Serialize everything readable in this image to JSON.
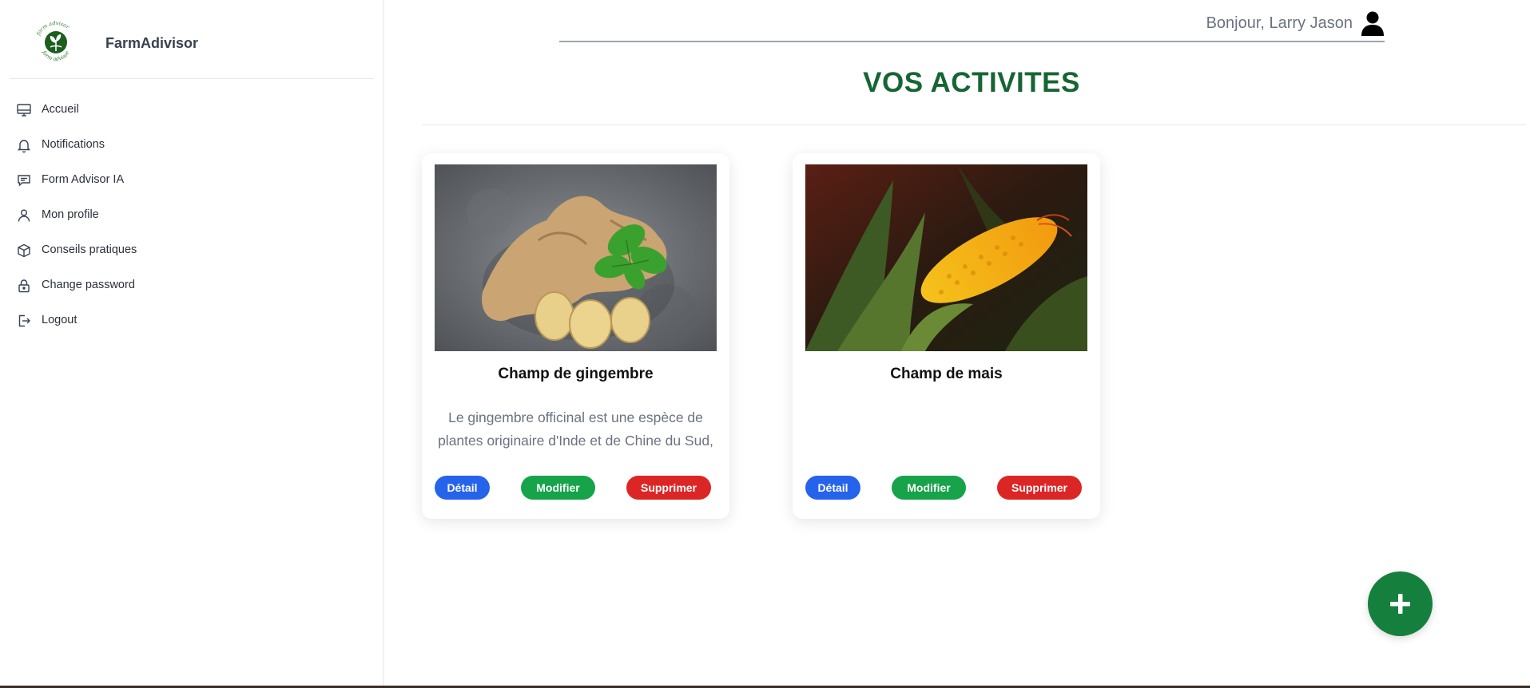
{
  "sidebar": {
    "brand": {
      "name": "FarmAdivisor",
      "logo_text_top": "form advisor",
      "logo_text_bottom": "form advisor"
    },
    "items": [
      {
        "label": "Accueil",
        "icon": "monitor-icon"
      },
      {
        "label": "Notifications",
        "icon": "bell-icon"
      },
      {
        "label": "Form Advisor IA",
        "icon": "chat-icon"
      },
      {
        "label": "Mon profile",
        "icon": "user-icon"
      },
      {
        "label": "Conseils pratiques",
        "icon": "cube-icon"
      },
      {
        "label": "Change password",
        "icon": "lock-icon"
      },
      {
        "label": "Logout",
        "icon": "logout-icon"
      }
    ]
  },
  "header": {
    "greeting": "Bonjour, Larry Jason",
    "user_icon": "user-solid-icon"
  },
  "main": {
    "title": "VOS ACTIVITES",
    "cards": [
      {
        "title": "Champ de gingembre",
        "description": "Le gingembre officinal est une espèce de plantes originaire d'Inde et de Chine du Sud, ... Elle appartient à la famille des ...",
        "image": "ginger-photo",
        "buttons": {
          "detail": "Détail",
          "modify": "Modifier",
          "delete": "Supprimer"
        }
      },
      {
        "title": "Champ de mais",
        "description": "",
        "image": "corn-photo",
        "buttons": {
          "detail": "Détail",
          "modify": "Modifier",
          "delete": "Supprimer"
        }
      }
    ],
    "fab_icon": "plus-icon"
  },
  "colors": {
    "brand_green": "#166534",
    "fab_green": "#15803d",
    "detail_blue": "#2563eb",
    "modify_green": "#16a34a",
    "delete_red": "#dc2626"
  }
}
